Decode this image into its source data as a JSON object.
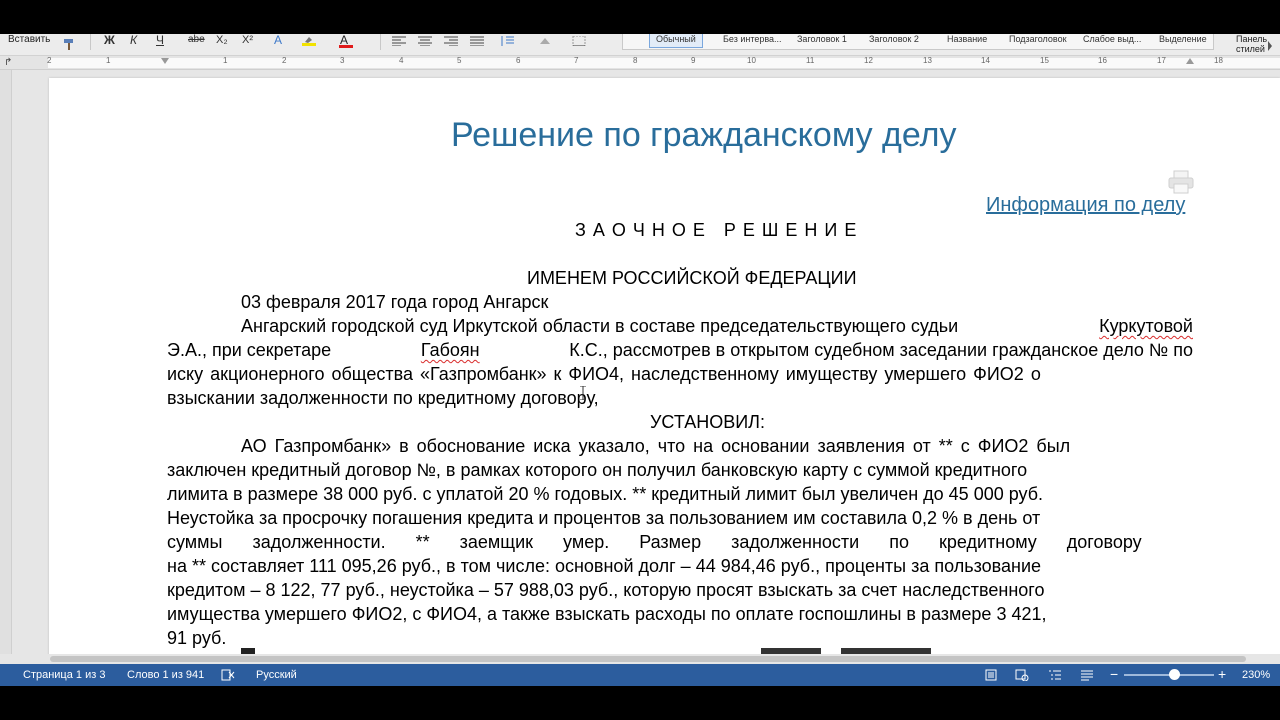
{
  "ribbon": {
    "paste_label": "Вставить",
    "format_buttons": [
      "Ж",
      "К",
      "Ч",
      "abe",
      "X₂",
      "X²",
      "A"
    ],
    "styles": [
      {
        "label": "Обычный",
        "active": true
      },
      {
        "label": "Без интерва...",
        "active": false
      },
      {
        "label": "Заголовок 1",
        "active": false
      },
      {
        "label": "Заголовок 2",
        "active": false
      },
      {
        "label": "Название",
        "active": false
      },
      {
        "label": "Подзаголовок",
        "active": false
      },
      {
        "label": "Слабое выд...",
        "active": false
      },
      {
        "label": "Выделение",
        "active": false
      }
    ],
    "styles_pane_line1": "Панель",
    "styles_pane_line2": "стилей"
  },
  "ruler": {
    "ticks": [
      "2",
      "1",
      "1",
      "2",
      "3",
      "4",
      "5",
      "6",
      "7",
      "8",
      "9",
      "10",
      "11",
      "12",
      "13",
      "14",
      "15",
      "16",
      "17",
      "18"
    ]
  },
  "document": {
    "title": "Решение по гражданскому делу",
    "info_link": "Информация по делу",
    "heading_zaochnoe": "З А О Ч Н О Е   Р Е Ш Е Н И Е",
    "heading_imenem": "ИМЕНЕМ РОССИЙСКОЙ ФЕДЕРАЦИИ",
    "date_line": "03 февраля 2017 года город Ангарск",
    "p1_l1a": "Ангарский городской суд Иркутской области в составе председательствующего судьи",
    "p1_l1b": "Куркутовой",
    "p1_l2a": "Э.А., при секретаре",
    "p1_l2b": "Габоян",
    "p1_l2c": "К.С., рассмотрев в открытом судебном заседании гражданское дело № по",
    "p1_l3": "иску акционерного общества «Газпромбанк» к ФИО4, наследственному имуществу умершего ФИО2 о",
    "p1_l4": "взыскании задолженности по кредитному договору,",
    "heading_ustanovil": "УСТАНОВИЛ:",
    "p2_l1": "АО Газпромбанк» в обоснование иска указало, что на основании заявления от ** с ФИО2 был",
    "p2_l2": "заключен кредитный договор №, в рамках которого он получил банковскую карту с суммой кредитного",
    "p2_l3": "лимита в размере 38 000 руб. с уплатой 20 % годовых. ** кредитный лимит был увеличен до 45 000 руб.",
    "p2_l4": "Неустойка за просрочку погашения кредита и процентов за пользованием им составила 0,2 % в день от",
    "p2_l5": "суммы задолженности. ** заемщик умер. Размер задолженности по кредитному договору",
    "p2_l6": "на ** составляет 111 095,26 руб., в том числе: основной долг – 44 984,46 руб., проценты за пользование",
    "p2_l7": "кредитом – 8 122, 77 руб., неустойка – 57 988,03 руб., которую просят взыскать за счет наследственного",
    "p2_l8": "имущества умершего ФИО2, с ФИО4, а также взыскать расходы по оплате госпошлины в размере 3 421,",
    "p2_l9": "91 руб."
  },
  "status": {
    "page": "Страница 1 из 3",
    "words": "Слово 1 из 941",
    "language": "Русский",
    "zoom": "230%",
    "zoom_fraction": 0.56
  },
  "colors": {
    "title_blue": "#296d9b",
    "status_bar": "#2c5d9e"
  }
}
